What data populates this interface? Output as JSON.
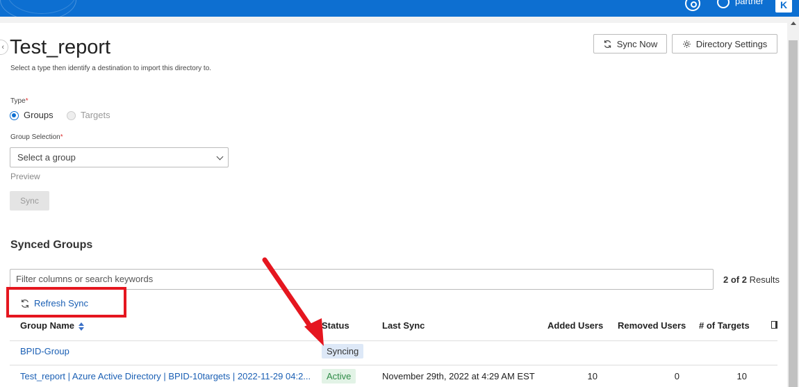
{
  "header": {
    "user_name": "partner",
    "brand_letter": "K"
  },
  "page": {
    "title": "Test_report",
    "subtitle": "Select a type then identify a destination to import this directory to."
  },
  "actions": {
    "sync_now": "Sync Now",
    "directory_settings": "Directory Settings"
  },
  "form": {
    "type_label": "Type",
    "required_mark": "*",
    "type_options": [
      "Groups",
      "Targets"
    ],
    "type_selected": "Groups",
    "group_selection_label": "Group Selection",
    "group_select_value": "Select a group",
    "preview_label": "Preview",
    "sync_button": "Sync"
  },
  "synced_groups": {
    "title": "Synced Groups",
    "filter_placeholder": "Filter columns or search keywords",
    "results_count": "2 of 2",
    "results_label": "Results",
    "refresh_label": "Refresh Sync",
    "columns": [
      "Group Name",
      "Status",
      "Last Sync",
      "Added Users",
      "Removed Users",
      "# of Targets"
    ],
    "rows": [
      {
        "group_name": "BPID-Group",
        "status": "Syncing",
        "last_sync": "",
        "added_users": "",
        "removed_users": "",
        "targets": ""
      },
      {
        "group_name": "Test_report | Azure Active Directory | BPID-10targets | 2022-11-29 04:2...",
        "status": "Active",
        "last_sync": "November 29th, 2022 at 4:29 AM EST",
        "added_users": "10",
        "removed_users": "0",
        "targets": "10"
      }
    ]
  },
  "colors": {
    "brand": "#0d6fd1",
    "link": "#1a5fb4",
    "annotation_red": "#e5161f",
    "active_green": "#2e8b47"
  },
  "icons": [
    "help-icon",
    "user-icon",
    "refresh-icon",
    "gear-icon",
    "sort-icon",
    "column-toggle-icon",
    "chevron-down-icon",
    "collapse-icon"
  ]
}
